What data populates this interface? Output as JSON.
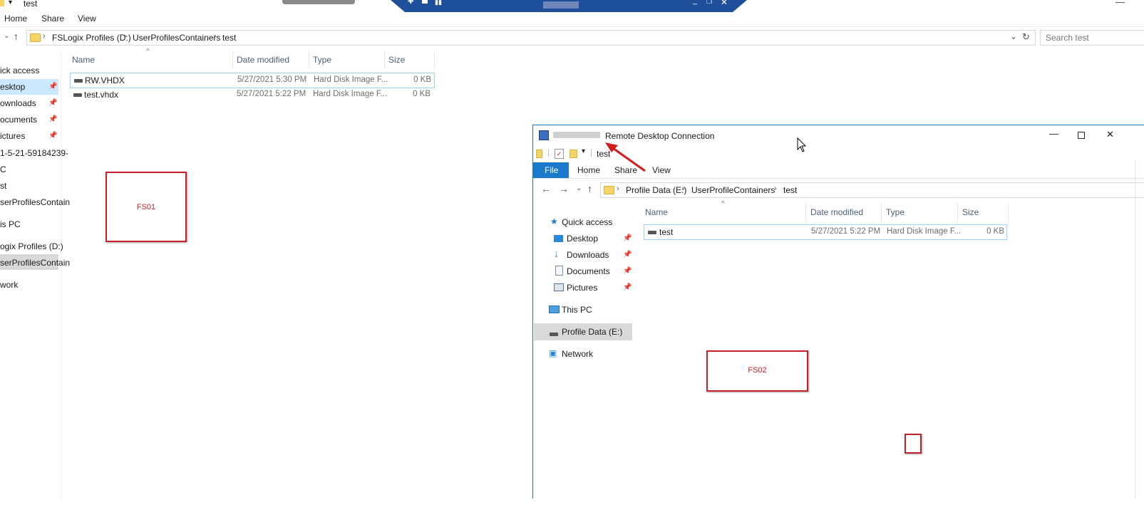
{
  "host_explorer": {
    "title": "test",
    "ribbon_tabs": [
      "Home",
      "Share",
      "View"
    ],
    "breadcrumb": [
      "FSLogix Profiles (D:)",
      "UserProfilesContainers",
      "test"
    ],
    "search_placeholder": "Search test",
    "columns": [
      "Name",
      "Date modified",
      "Type",
      "Size"
    ],
    "files": [
      {
        "name": "RW.VHDX",
        "date": "5/27/2021 5:30 PM",
        "type": "Hard Disk Image F...",
        "size": "0 KB"
      },
      {
        "name": "test.vhdx",
        "date": "5/27/2021 5:22 PM",
        "type": "Hard Disk Image F...",
        "size": "0 KB"
      }
    ],
    "nav": [
      {
        "label": "ick access"
      },
      {
        "label": "esktop"
      },
      {
        "label": "ownloads"
      },
      {
        "label": "ocuments"
      },
      {
        "label": "ictures"
      },
      {
        "label": "1-5-21-59184239-"
      },
      {
        "label": "C"
      },
      {
        "label": "st"
      },
      {
        "label": "serProfilesContain"
      },
      {
        "label": "is PC"
      },
      {
        "label": "ogix Profiles (D:)"
      },
      {
        "label": "serProfilesContain"
      },
      {
        "label": "work"
      }
    ],
    "annotation": "FS01"
  },
  "rdc_window": {
    "title": "Remote Desktop Connection",
    "qat_title": "test",
    "ribbon_tabs": [
      "File",
      "Home",
      "Share",
      "View"
    ],
    "breadcrumb": [
      "Profile Data (E:)",
      "UserProfileContainers",
      "test"
    ],
    "columns": [
      "Name",
      "Date modified",
      "Type",
      "Size"
    ],
    "files": [
      {
        "name": "test",
        "date": "5/27/2021 5:22 PM",
        "type": "Hard Disk Image F...",
        "size": "0 KB"
      }
    ],
    "nav": {
      "quick_access": "Quick access",
      "desktop": "Desktop",
      "downloads": "Downloads",
      "documents": "Documents",
      "pictures": "Pictures",
      "this_pc": "This PC",
      "profile_data": "Profile Data (E:)",
      "network": "Network"
    },
    "annotation": "FS02"
  },
  "colors": {
    "accent": "#1979ca",
    "selected_bg": "#cce8ff",
    "annotation_red": "#c8202a",
    "rdc_bar": "#1d4f9a"
  }
}
